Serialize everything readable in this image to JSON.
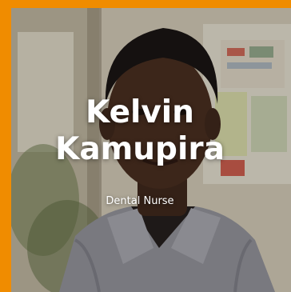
{
  "profile": {
    "first_name": "Kelvin",
    "last_name": "Kamupira",
    "role": "Dental Nurse",
    "photo_icon": "person-photo"
  },
  "colors": {
    "border_accent": "#f08c00",
    "text": "#ffffff"
  }
}
